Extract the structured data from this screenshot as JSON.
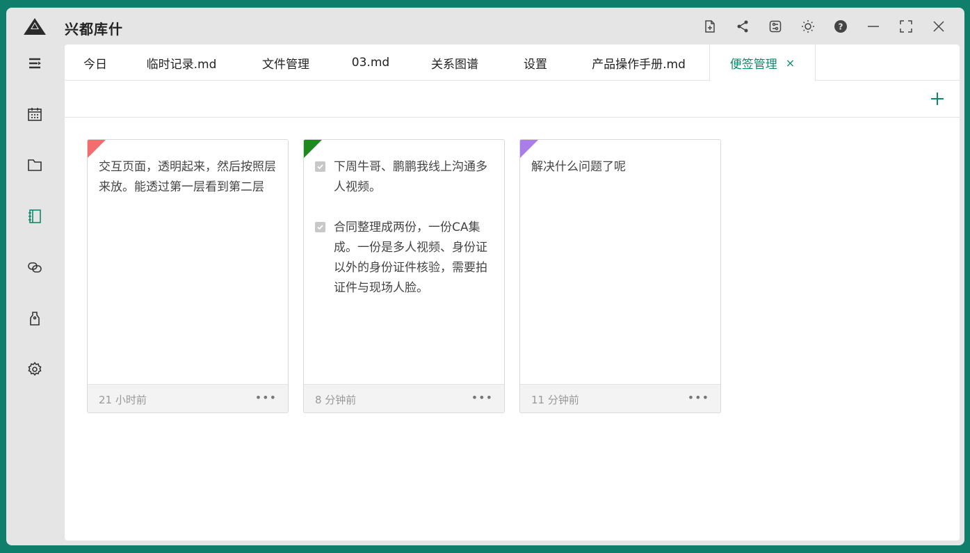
{
  "app": {
    "title": "兴都库什"
  },
  "titlebar_icons": [
    {
      "name": "new-file-icon"
    },
    {
      "name": "share-icon"
    },
    {
      "name": "settings-panel-icon"
    },
    {
      "name": "theme-sun-icon"
    },
    {
      "name": "help-icon"
    },
    {
      "name": "minimize-icon"
    },
    {
      "name": "fullscreen-icon"
    },
    {
      "name": "close-icon"
    }
  ],
  "sidebar": {
    "items": [
      {
        "icon": "menu-icon"
      },
      {
        "icon": "calendar-icon"
      },
      {
        "icon": "folder-icon"
      },
      {
        "icon": "notebook-icon",
        "active": true
      },
      {
        "icon": "link-icon"
      },
      {
        "icon": "tag-icon"
      },
      {
        "icon": "gear-icon"
      }
    ],
    "active_color": "#0d8a6a"
  },
  "tabs": [
    {
      "label": "今日"
    },
    {
      "label": "临时记录.md"
    },
    {
      "label": "文件管理"
    },
    {
      "label": "03.md"
    },
    {
      "label": "关系图谱"
    },
    {
      "label": "设置"
    },
    {
      "label": "产品操作手册.md"
    },
    {
      "label": "便签管理",
      "active": true,
      "close": "×"
    }
  ],
  "toolbar": {
    "add_icon": "plus-icon"
  },
  "notes": [
    {
      "corner_color": "#f26d6d",
      "text": "交互页面，透明起来，然后按照层来放。能透过第一层看到第二层",
      "time": "21 小时前",
      "more": "•••"
    },
    {
      "corner_color": "#1e8a1e",
      "todos": [
        {
          "checked": true,
          "text": "下周牛哥、鹏鹏我线上沟通多人视频。"
        },
        {
          "checked": true,
          "text": "合同整理成两份，一份CA集成。一份是多人视频、身份证以外的身份证件核验，需要拍证件与现场人脸。"
        }
      ],
      "time": "8 分钟前",
      "more": "•••"
    },
    {
      "corner_color": "#a97ee8",
      "text": "解决什么问题了呢",
      "time": "11 分钟前",
      "more": "•••"
    }
  ]
}
